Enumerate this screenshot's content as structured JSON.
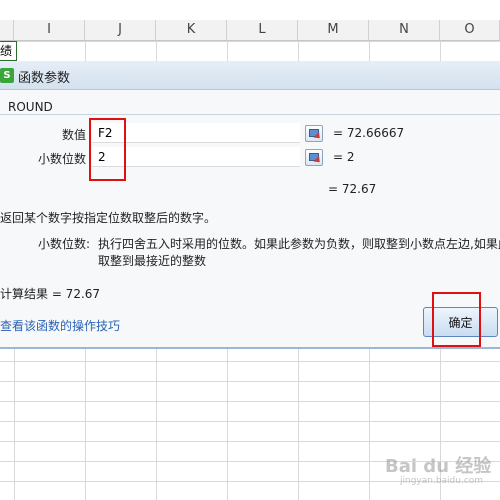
{
  "sheet": {
    "columns": [
      "I",
      "J",
      "K",
      "L",
      "M",
      "N",
      "O"
    ],
    "cell_fragment": "绩"
  },
  "dialog": {
    "icon_letter": "S",
    "title": "函数参数",
    "function_name": "ROUND",
    "args": [
      {
        "label": "数值",
        "value": "F2",
        "result": "= 72.66667"
      },
      {
        "label": "小数位数",
        "value": "2",
        "result": "= 2"
      }
    ],
    "formula_result": "= 72.67",
    "description": "返回某个数字按指定位数取整后的数字。",
    "param_name": "小数位数:",
    "param_desc_line1": "执行四舍五入时采用的位数。如果此参数为负数，则取整到小数点左边,如果此",
    "param_desc_line2": "取整到最接近的整数",
    "calc_result": "计算结果 = 72.67",
    "help_link": "查看该函数的操作技巧",
    "ok_label": "确定"
  },
  "watermark": {
    "text": "Bai du 经验",
    "sub": "jingyan.baidu.com"
  },
  "colors": {
    "highlight": "#e01010",
    "link": "#2a62b6",
    "app_icon": "#3aa63a"
  }
}
